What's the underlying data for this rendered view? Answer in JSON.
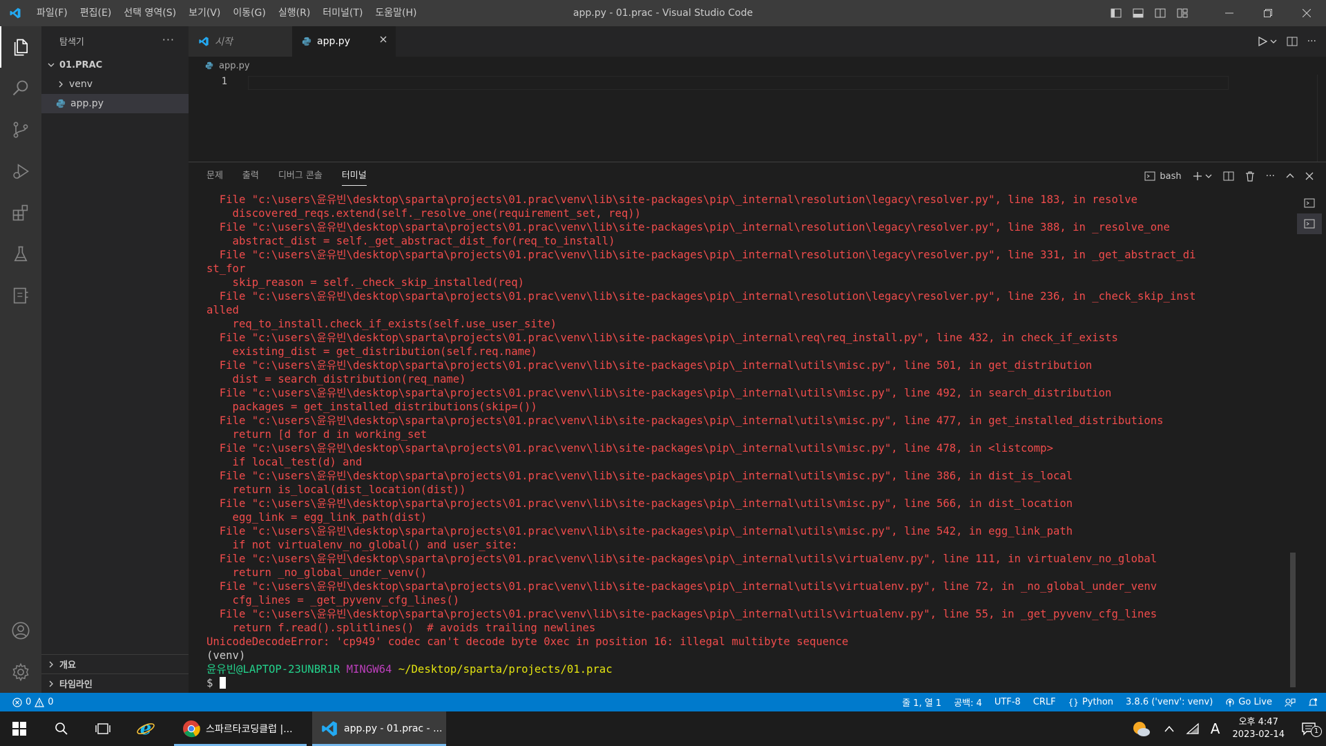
{
  "app": {
    "window_title": "app.py - 01.prac - Visual Studio Code",
    "menu": [
      "파일(F)",
      "편집(E)",
      "선택 영역(S)",
      "보기(V)",
      "이동(G)",
      "실행(R)",
      "터미널(T)",
      "도움말(H)"
    ]
  },
  "sidebar": {
    "header": "탐색기",
    "more": "···",
    "root_folder": "01.PRAC",
    "items": [
      {
        "label": "venv",
        "type": "folder"
      },
      {
        "label": "app.py",
        "type": "python-file"
      }
    ],
    "bottom_sections": [
      "개요",
      "타임라인"
    ]
  },
  "tabs": [
    {
      "label": "시작",
      "active": false
    },
    {
      "label": "app.py",
      "active": true
    }
  ],
  "breadcrumb": "app.py",
  "editor": {
    "line_number": "1"
  },
  "panel": {
    "tabs": [
      "문제",
      "출력",
      "디버그 콘솔",
      "터미널"
    ],
    "active_tab": "터미널",
    "shell_label": "bash"
  },
  "terminal": {
    "lines": [
      [
        {
          "t": "  File \"c:\\users\\윤유빈\\desktop\\sparta\\projects\\01.prac\\venv\\lib\\site-packages\\pip\\_internal\\resolution\\legacy\\resolver.py\", line 183, in resolve",
          "c": "r"
        }
      ],
      [
        {
          "t": "    discovered_reqs.extend(self._resolve_one(requirement_set, req))",
          "c": "r"
        }
      ],
      [
        {
          "t": "  File \"c:\\users\\윤유빈\\desktop\\sparta\\projects\\01.prac\\venv\\lib\\site-packages\\pip\\_internal\\resolution\\legacy\\resolver.py\", line 388, in _resolve_one",
          "c": "r"
        }
      ],
      [
        {
          "t": "    abstract_dist = self._get_abstract_dist_for(req_to_install)",
          "c": "r"
        }
      ],
      [
        {
          "t": "  File \"c:\\users\\윤유빈\\desktop\\sparta\\projects\\01.prac\\venv\\lib\\site-packages\\pip\\_internal\\resolution\\legacy\\resolver.py\", line 331, in _get_abstract_di",
          "c": "r"
        }
      ],
      [
        {
          "t": "st_for",
          "c": "r"
        }
      ],
      [
        {
          "t": "    skip_reason = self._check_skip_installed(req)",
          "c": "r"
        }
      ],
      [
        {
          "t": "  File \"c:\\users\\윤유빈\\desktop\\sparta\\projects\\01.prac\\venv\\lib\\site-packages\\pip\\_internal\\resolution\\legacy\\resolver.py\", line 236, in _check_skip_inst",
          "c": "r"
        }
      ],
      [
        {
          "t": "alled",
          "c": "r"
        }
      ],
      [
        {
          "t": "    req_to_install.check_if_exists(self.use_user_site)",
          "c": "r"
        }
      ],
      [
        {
          "t": "  File \"c:\\users\\윤유빈\\desktop\\sparta\\projects\\01.prac\\venv\\lib\\site-packages\\pip\\_internal\\req\\req_install.py\", line 432, in check_if_exists",
          "c": "r"
        }
      ],
      [
        {
          "t": "    existing_dist = get_distribution(self.req.name)",
          "c": "r"
        }
      ],
      [
        {
          "t": "  File \"c:\\users\\윤유빈\\desktop\\sparta\\projects\\01.prac\\venv\\lib\\site-packages\\pip\\_internal\\utils\\misc.py\", line 501, in get_distribution",
          "c": "r"
        }
      ],
      [
        {
          "t": "    dist = search_distribution(req_name)",
          "c": "r"
        }
      ],
      [
        {
          "t": "  File \"c:\\users\\윤유빈\\desktop\\sparta\\projects\\01.prac\\venv\\lib\\site-packages\\pip\\_internal\\utils\\misc.py\", line 492, in search_distribution",
          "c": "r"
        }
      ],
      [
        {
          "t": "    packages = get_installed_distributions(skip=())",
          "c": "r"
        }
      ],
      [
        {
          "t": "  File \"c:\\users\\윤유빈\\desktop\\sparta\\projects\\01.prac\\venv\\lib\\site-packages\\pip\\_internal\\utils\\misc.py\", line 477, in get_installed_distributions",
          "c": "r"
        }
      ],
      [
        {
          "t": "    return [d for d in working_set",
          "c": "r"
        }
      ],
      [
        {
          "t": "  File \"c:\\users\\윤유빈\\desktop\\sparta\\projects\\01.prac\\venv\\lib\\site-packages\\pip\\_internal\\utils\\misc.py\", line 478, in <listcomp>",
          "c": "r"
        }
      ],
      [
        {
          "t": "    if local_test(d) and",
          "c": "r"
        }
      ],
      [
        {
          "t": "  File \"c:\\users\\윤유빈\\desktop\\sparta\\projects\\01.prac\\venv\\lib\\site-packages\\pip\\_internal\\utils\\misc.py\", line 386, in dist_is_local",
          "c": "r"
        }
      ],
      [
        {
          "t": "    return is_local(dist_location(dist))",
          "c": "r"
        }
      ],
      [
        {
          "t": "  File \"c:\\users\\윤유빈\\desktop\\sparta\\projects\\01.prac\\venv\\lib\\site-packages\\pip\\_internal\\utils\\misc.py\", line 566, in dist_location",
          "c": "r"
        }
      ],
      [
        {
          "t": "    egg_link = egg_link_path(dist)",
          "c": "r"
        }
      ],
      [
        {
          "t": "  File \"c:\\users\\윤유빈\\desktop\\sparta\\projects\\01.prac\\venv\\lib\\site-packages\\pip\\_internal\\utils\\misc.py\", line 542, in egg_link_path",
          "c": "r"
        }
      ],
      [
        {
          "t": "    if not virtualenv_no_global() and user_site:",
          "c": "r"
        }
      ],
      [
        {
          "t": "  File \"c:\\users\\윤유빈\\desktop\\sparta\\projects\\01.prac\\venv\\lib\\site-packages\\pip\\_internal\\utils\\virtualenv.py\", line 111, in virtualenv_no_global",
          "c": "r"
        }
      ],
      [
        {
          "t": "    return _no_global_under_venv()",
          "c": "r"
        }
      ],
      [
        {
          "t": "  File \"c:\\users\\윤유빈\\desktop\\sparta\\projects\\01.prac\\venv\\lib\\site-packages\\pip\\_internal\\utils\\virtualenv.py\", line 72, in _no_global_under_venv",
          "c": "r"
        }
      ],
      [
        {
          "t": "    cfg_lines = _get_pyvenv_cfg_lines()",
          "c": "r"
        }
      ],
      [
        {
          "t": "  File \"c:\\users\\윤유빈\\desktop\\sparta\\projects\\01.prac\\venv\\lib\\site-packages\\pip\\_internal\\utils\\virtualenv.py\", line 55, in _get_pyvenv_cfg_lines",
          "c": "r"
        }
      ],
      [
        {
          "t": "    return f.read().splitlines()  # avoids trailing newlines",
          "c": "r"
        }
      ],
      [
        {
          "t": "UnicodeDecodeError: 'cp949' codec can't decode byte 0xec in position 16: illegal multibyte sequence",
          "c": "r"
        }
      ],
      [
        {
          "t": "(venv)",
          "c": "w"
        }
      ],
      [
        {
          "t": "윤유빈@LAPTOP-23UNBR1R",
          "c": "g"
        },
        {
          "t": " ",
          "c": "w"
        },
        {
          "t": "MINGW64",
          "c": "m"
        },
        {
          "t": " ",
          "c": "w"
        },
        {
          "t": "~/Desktop/sparta/projects/01.prac",
          "c": "y"
        }
      ],
      [
        {
          "t": "$ ",
          "c": "w"
        }
      ]
    ]
  },
  "statusbar": {
    "errors": "0",
    "warnings": "0",
    "position": "줄 1, 열 1",
    "indent": "공백: 4",
    "encoding": "UTF-8",
    "eol": "CRLF",
    "language": "Python",
    "interpreter": "3.8.6 ('venv': venv)",
    "golive": "Go Live"
  },
  "taskbar": {
    "apps": [
      {
        "label": "스파르타코딩클럽 |...",
        "icon": "chrome-icon",
        "active": false
      },
      {
        "label": "app.py - 01.prac - ...",
        "icon": "vscode-icon",
        "active": true
      }
    ],
    "ime": "A",
    "time": "오후 4:47",
    "date": "2023-02-14",
    "notification_count": "1"
  },
  "colors": {
    "accent": "#007acc",
    "terminal_error": "#f14c4c",
    "activity_bar": "#333333",
    "sidebar": "#252526",
    "editor": "#1e1e1e"
  }
}
